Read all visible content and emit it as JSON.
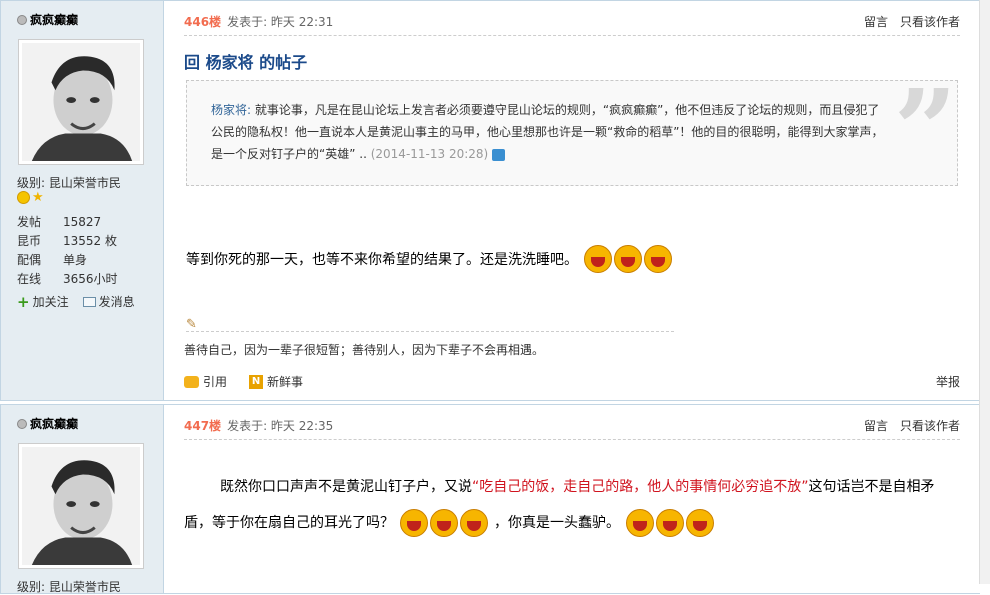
{
  "posts": [
    {
      "username": "疯疯癫癫",
      "level": "级别: 昆山荣誉市民",
      "stats": [
        {
          "label": "发帖",
          "value": "15827"
        },
        {
          "label": "昆币",
          "value": "13552 枚"
        },
        {
          "label": "配偶",
          "value": "单身"
        },
        {
          "label": "在线",
          "value": "3656小时"
        }
      ],
      "actions": {
        "follow": "加关注",
        "message": "发消息"
      },
      "floor": "446楼",
      "posted": "发表于: 昨天 22:31",
      "header_links": {
        "comment": "留言",
        "author_only": "只看该作者"
      },
      "title": "回 杨家将 的帖子",
      "quote": {
        "name": "杨家将:",
        "text": "就事论事，凡是在昆山论坛上发言者必须要遵守昆山论坛的规则，“疯疯癫癫”，他不但违反了论坛的规则，而且侵犯了公民的隐私权！他一直说本人是黄泥山事主的马甲，他心里想那也许是一颗“救命的稻草”！他的目的很聪明，能得到大家掌声，是一个反对钉子户的“英雄” ..",
        "date": "(2014-11-13 20:28)"
      },
      "body": "等到你死的那一天，也等不来你希望的结果了。还是洗洗睡吧。",
      "signature": "善待自己，因为一辈子很短暂；善待别人，因为下辈子不会再相遇。",
      "footer": {
        "quote": "引用",
        "news": "新鲜事",
        "report": "举报"
      }
    },
    {
      "username": "疯疯癫癫",
      "level": "级别: 昆山荣誉市民",
      "floor": "447楼",
      "posted": "发表于: 昨天 22:35",
      "header_links": {
        "comment": "留言",
        "author_only": "只看该作者"
      },
      "body_a": "既然你口口声声不是黄泥山钉子户，又说",
      "body_red": "“吃自己的饭，走自己的路，他人的事情何必穷追不放”",
      "body_b": "这句话岂不是自相矛盾，等于你在扇自己的耳光了吗？",
      "body_c": "，你真是一头蠢驴。"
    }
  ],
  "colors": {
    "floor": "#f26c4f",
    "title": "#1b4a8a",
    "sidebar": "#e5edf2",
    "red_text": "#d0131e"
  }
}
